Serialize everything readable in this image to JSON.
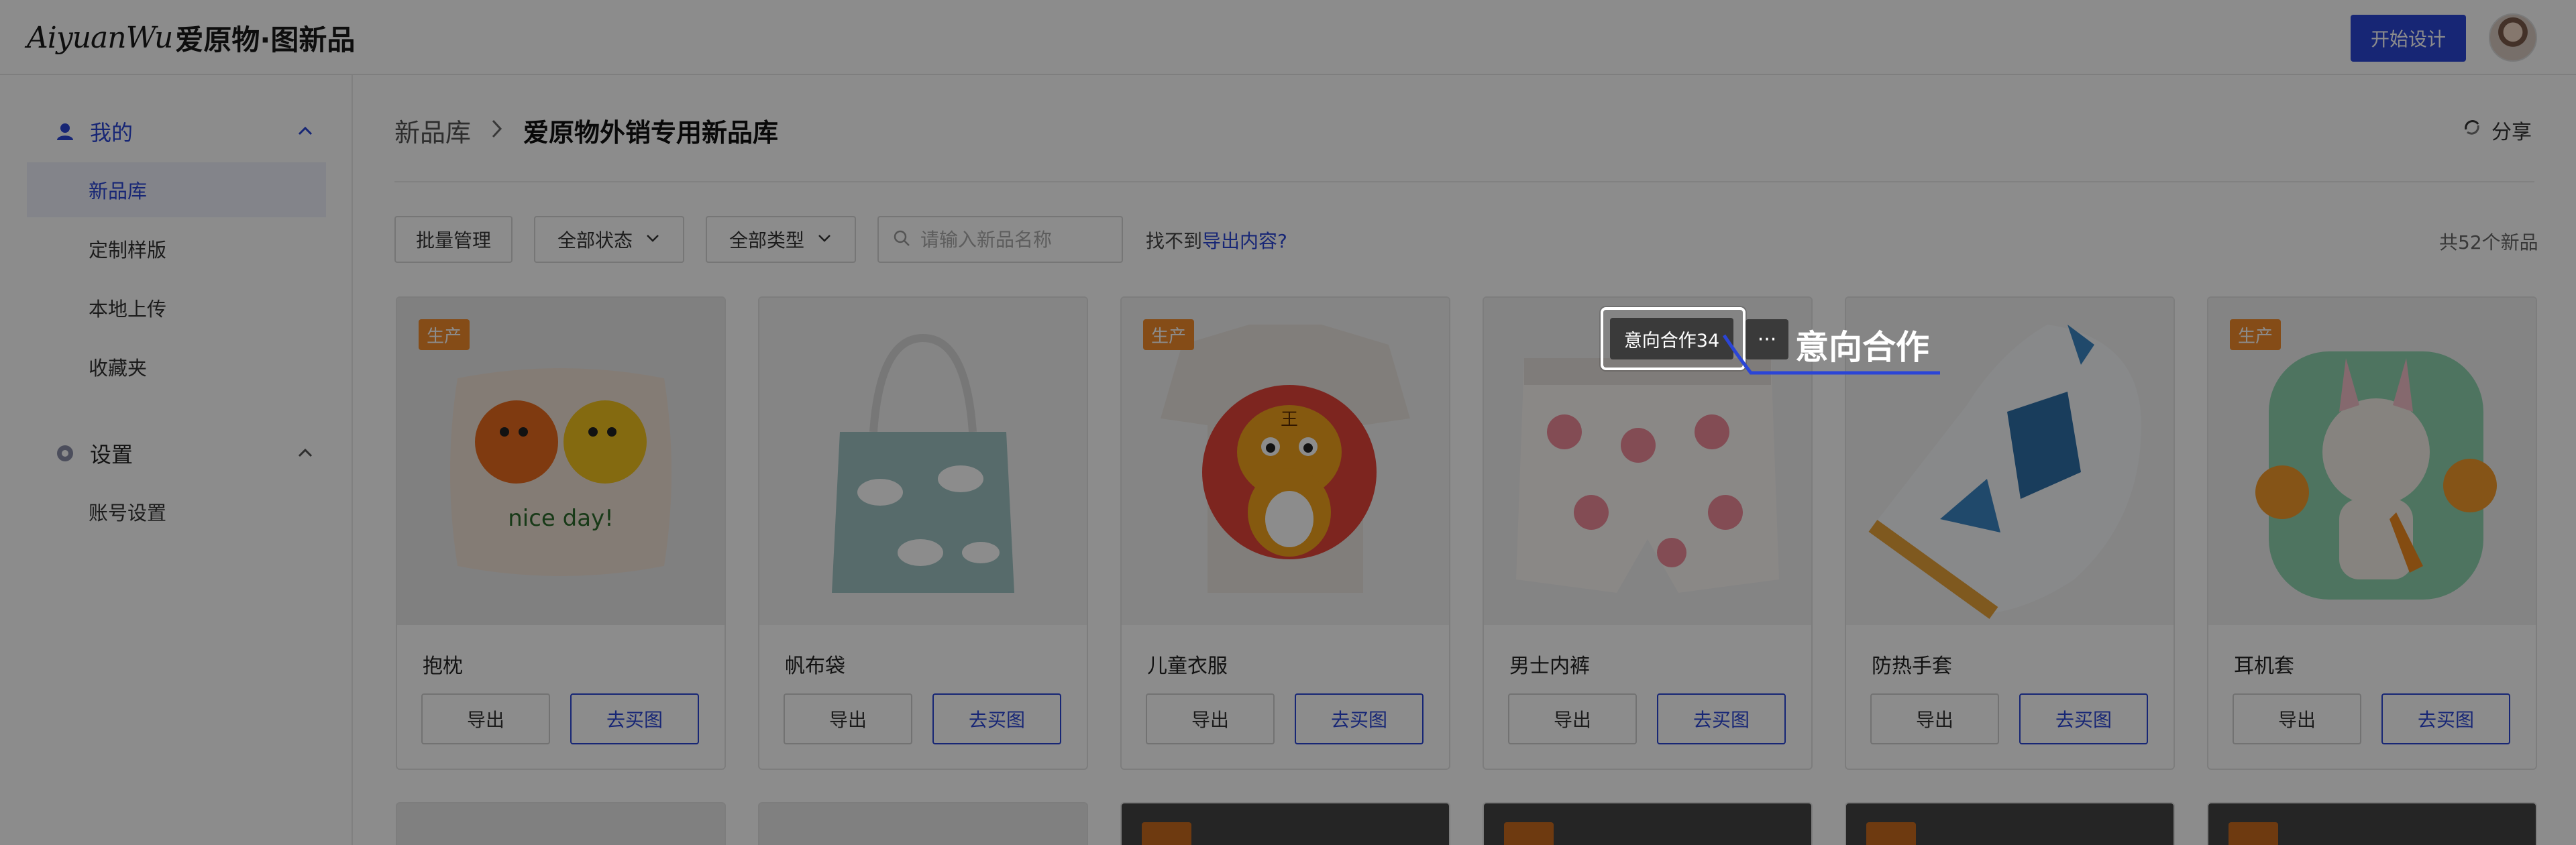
{
  "header": {
    "logo_script": "AiyuanWu",
    "logo_cn": "爱原物·图新品",
    "start_button": "开始设计"
  },
  "sidebar": {
    "group_mine": "我的",
    "items_mine": [
      "新品库",
      "定制样版",
      "本地上传",
      "收藏夹"
    ],
    "group_settings": "设置",
    "items_settings": [
      "账号设置"
    ]
  },
  "breadcrumb": {
    "root": "新品库",
    "current": "爱原物外销专用新品库"
  },
  "share_label": "分享",
  "toolbar": {
    "batch": "批量管理",
    "status": "全部状态",
    "type": "全部类型",
    "search_placeholder": "请输入新品名称",
    "notfound_prefix": "找不到",
    "notfound_link": "导出内容?",
    "total": "共52个新品"
  },
  "cards": [
    {
      "title": "抱枕",
      "badge": "生产",
      "export": "导出",
      "buy": "去买图"
    },
    {
      "title": "帆布袋",
      "badge": "",
      "export": "导出",
      "buy": "去买图"
    },
    {
      "title": "儿童衣服",
      "badge": "生产",
      "export": "导出",
      "buy": "去买图"
    },
    {
      "title": "男士内裤",
      "badge": "",
      "export": "导出",
      "buy": "去买图"
    },
    {
      "title": "防热手套",
      "badge": "",
      "export": "导出",
      "buy": "去买图"
    },
    {
      "title": "耳机套",
      "badge": "生产",
      "export": "导出",
      "buy": "去买图"
    }
  ],
  "pillow_text": "nice day!",
  "tiger_glyph": "王",
  "tooltip": {
    "tag": "意向合作34",
    "more": "···",
    "callout": "意向合作"
  },
  "colors": {
    "accent": "#2b45d6",
    "badge": "#f28a2a",
    "overlay": "rgba(0,0,0,0.45)"
  }
}
